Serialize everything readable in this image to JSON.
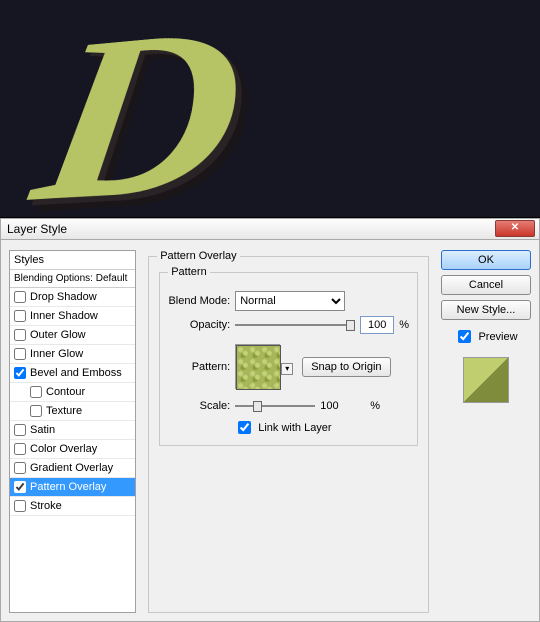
{
  "canvasLetter": "D",
  "dialog": {
    "title": "Layer Style",
    "closeGlyph": "✕"
  },
  "stylesPanel": {
    "header": "Styles",
    "blending": "Blending Options: Default",
    "items": [
      {
        "label": "Drop Shadow",
        "checked": false,
        "selected": false,
        "indent": false
      },
      {
        "label": "Inner Shadow",
        "checked": false,
        "selected": false,
        "indent": false
      },
      {
        "label": "Outer Glow",
        "checked": false,
        "selected": false,
        "indent": false
      },
      {
        "label": "Inner Glow",
        "checked": false,
        "selected": false,
        "indent": false
      },
      {
        "label": "Bevel and Emboss",
        "checked": true,
        "selected": false,
        "indent": false
      },
      {
        "label": "Contour",
        "checked": false,
        "selected": false,
        "indent": true
      },
      {
        "label": "Texture",
        "checked": false,
        "selected": false,
        "indent": true
      },
      {
        "label": "Satin",
        "checked": false,
        "selected": false,
        "indent": false
      },
      {
        "label": "Color Overlay",
        "checked": false,
        "selected": false,
        "indent": false
      },
      {
        "label": "Gradient Overlay",
        "checked": false,
        "selected": false,
        "indent": false
      },
      {
        "label": "Pattern Overlay",
        "checked": true,
        "selected": true,
        "indent": false
      },
      {
        "label": "Stroke",
        "checked": false,
        "selected": false,
        "indent": false
      }
    ]
  },
  "centerPanel": {
    "groupTitle": "Pattern Overlay",
    "subGroupTitle": "Pattern",
    "blendModeLabel": "Blend Mode:",
    "blendModeValue": "Normal",
    "opacityLabel": "Opacity:",
    "opacityValue": "100",
    "opacityPct": "%",
    "patternLabel": "Pattern:",
    "snapBtn": "Snap to Origin",
    "scaleLabel": "Scale:",
    "scaleValue": "100",
    "scalePct": "%",
    "linkLabel": "Link with Layer",
    "linkChecked": true,
    "arrowGlyph": "▾"
  },
  "rightPanel": {
    "ok": "OK",
    "cancel": "Cancel",
    "newStyle": "New Style...",
    "previewLabel": "Preview",
    "previewChecked": true
  }
}
